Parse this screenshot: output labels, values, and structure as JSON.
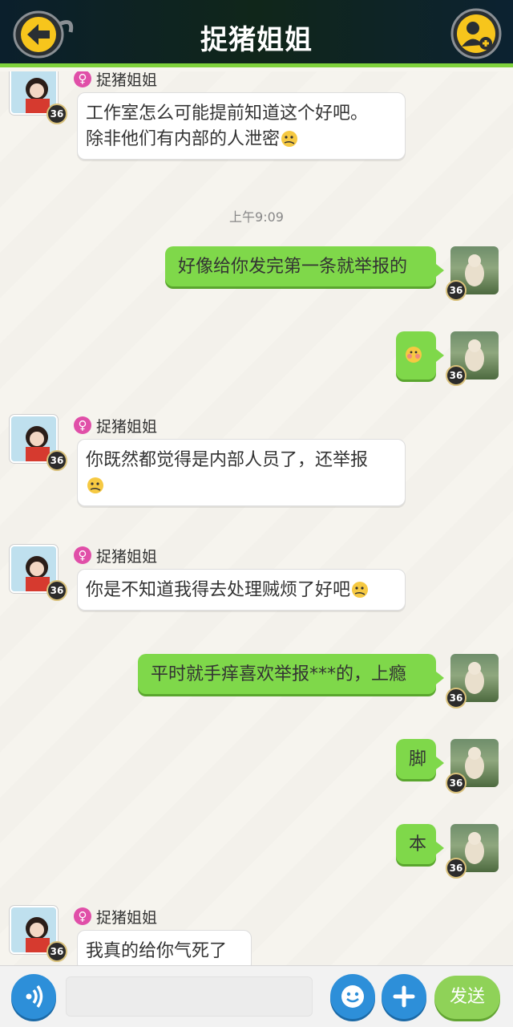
{
  "header": {
    "title": "捉猪姐姐",
    "back_icon": "arrow-left-icon",
    "add_friend_icon": "add-user-icon",
    "accent": "#7fd23c"
  },
  "timestamp": "上午9:09",
  "level": "36",
  "sender_name": "捉猪姐姐",
  "messages": [
    {
      "from": "her",
      "line1": "工作室怎么可能提前知道这个好吧。",
      "line2": "除非他们有内部的人泄密"
    },
    {
      "from": "me",
      "text": "好像给你发完第一条就举报的"
    },
    {
      "from": "me",
      "text": ""
    },
    {
      "from": "her",
      "line1": "你既然都觉得是内部人员了，还举报",
      "line2": ""
    },
    {
      "from": "her",
      "line1": "你是不知道我得去处理贼烦了好吧",
      "line2": ""
    },
    {
      "from": "me",
      "text": "平时就手痒喜欢举报***的，上瘾"
    },
    {
      "from": "me",
      "text": "脚"
    },
    {
      "from": "me",
      "text": "本"
    },
    {
      "from": "her",
      "line1": "我真的给你气死了",
      "line2": ""
    }
  ],
  "input": {
    "value": "",
    "placeholder": ""
  },
  "send_label": "发送",
  "colors": {
    "outgoing_bubble": "#7fd84a",
    "incoming_bubble": "#ffffff",
    "button_blue": "#2d8fd9"
  }
}
